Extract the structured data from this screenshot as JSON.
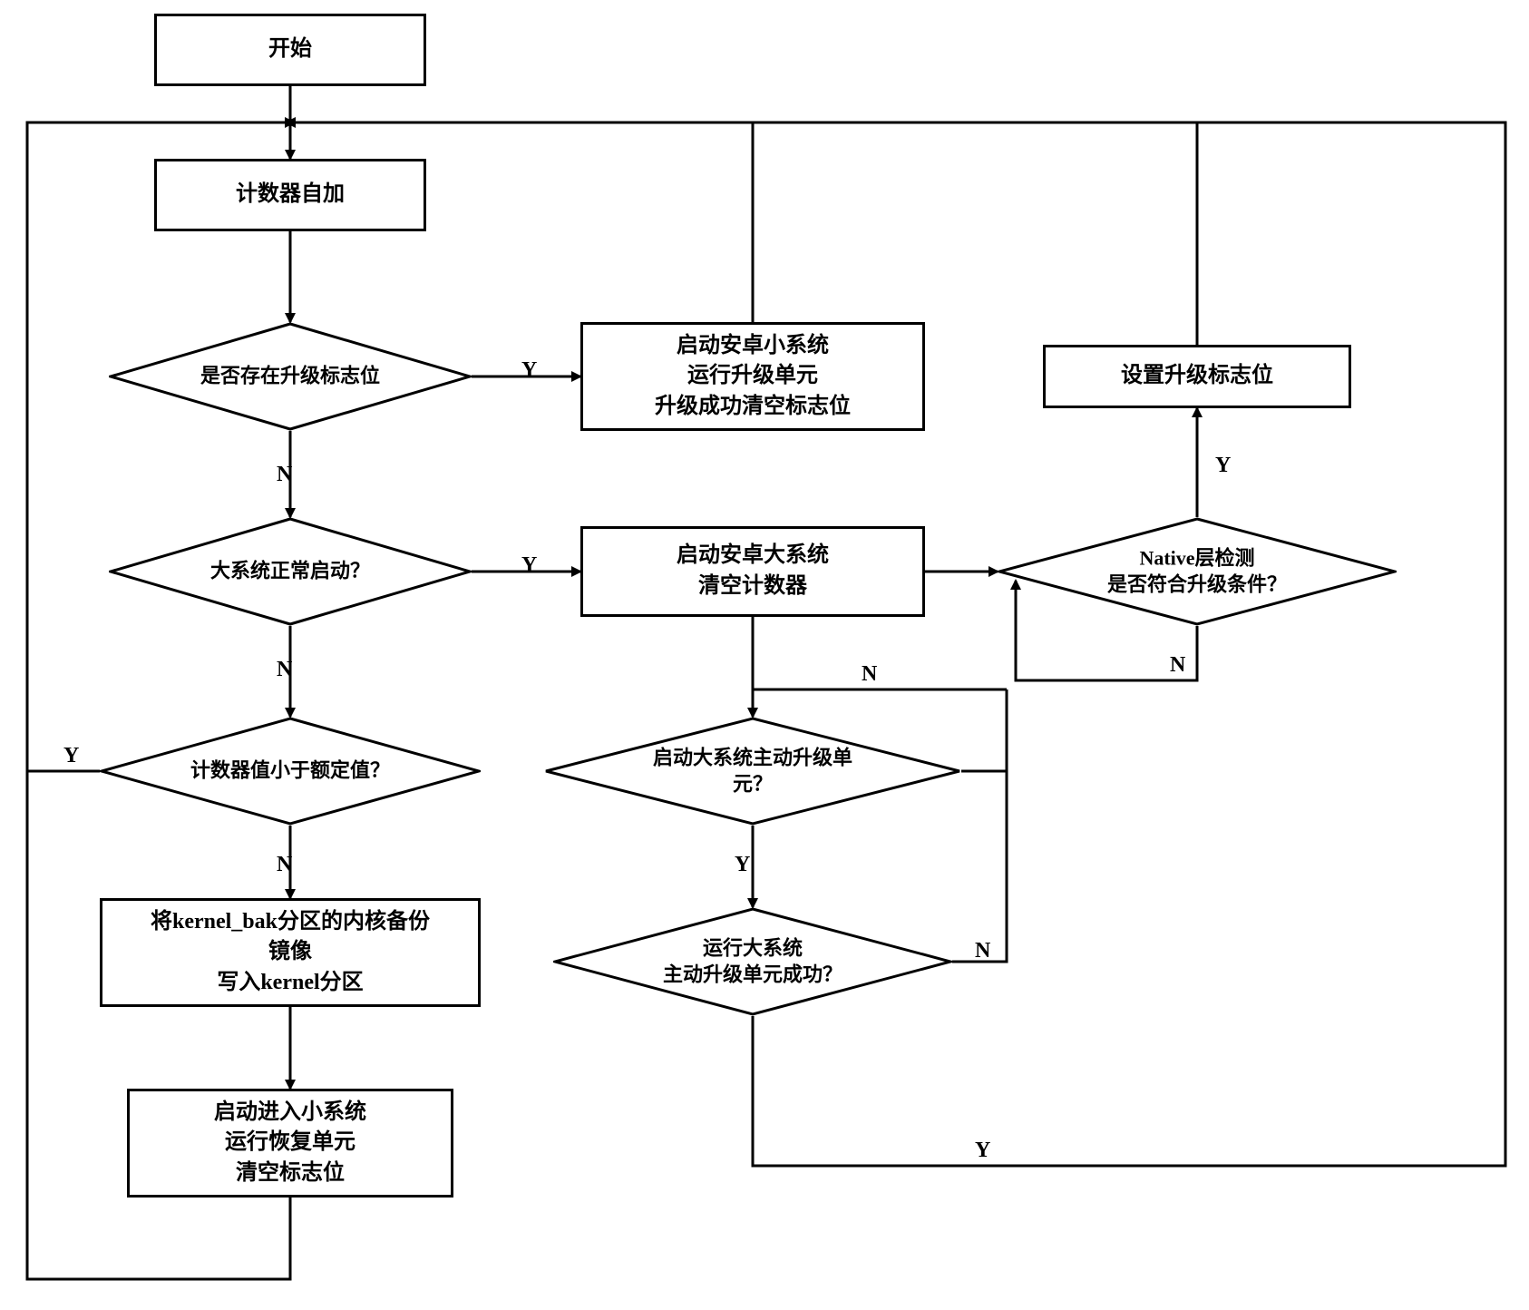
{
  "nodes": {
    "start": "开始",
    "counter_inc": "计数器自加",
    "upgrade_flag_q": "是否存在升级标志位",
    "boot_small": "启动安卓小系统\n运行升级单元\n升级成功清空标志位",
    "big_boot_q": "大系统正常启动？",
    "boot_big": "启动安卓大系统\n清空计数器",
    "counter_lt_q": "计数器值小于额定值？",
    "write_kernel": "将kernel_bak分区的内核备份\n镜像\n写入kernel分区",
    "enter_small": "启动进入小系统\n运行恢复单元\n清空标志位",
    "start_active_q": "启动大系统主动升级单\n元？",
    "run_active_q": "运行大系统\n主动升级单元成功？",
    "native_q": "Native层检测\n是否符合升级条件？",
    "set_flag": "设置升级标志位"
  },
  "labels": {
    "Y": "Y",
    "N": "N"
  },
  "chart_data": {
    "type": "flowchart",
    "nodes": [
      {
        "id": "start",
        "type": "terminal",
        "text": "开始"
      },
      {
        "id": "counter_inc",
        "type": "process",
        "text": "计数器自加"
      },
      {
        "id": "upgrade_flag_q",
        "type": "decision",
        "text": "是否存在升级标志位"
      },
      {
        "id": "boot_small",
        "type": "process",
        "text": "启动安卓小系统 运行升级单元 升级成功清空标志位"
      },
      {
        "id": "big_boot_q",
        "type": "decision",
        "text": "大系统正常启动？"
      },
      {
        "id": "boot_big",
        "type": "process",
        "text": "启动安卓大系统 清空计数器"
      },
      {
        "id": "counter_lt_q",
        "type": "decision",
        "text": "计数器值小于额定值？"
      },
      {
        "id": "write_kernel",
        "type": "process",
        "text": "将kernel_bak分区的内核备份镜像 写入kernel分区"
      },
      {
        "id": "enter_small",
        "type": "process",
        "text": "启动进入小系统 运行恢复单元 清空标志位"
      },
      {
        "id": "start_active_q",
        "type": "decision",
        "text": "启动大系统主动升级单元？"
      },
      {
        "id": "run_active_q",
        "type": "decision",
        "text": "运行大系统 主动升级单元成功？"
      },
      {
        "id": "native_q",
        "type": "decision",
        "text": "Native层检测 是否符合升级条件？"
      },
      {
        "id": "set_flag",
        "type": "process",
        "text": "设置升级标志位"
      }
    ],
    "edges": [
      {
        "from": "start",
        "to": "counter_inc"
      },
      {
        "from": "counter_inc",
        "to": "upgrade_flag_q"
      },
      {
        "from": "upgrade_flag_q",
        "to": "boot_small",
        "label": "Y"
      },
      {
        "from": "upgrade_flag_q",
        "to": "big_boot_q",
        "label": "N"
      },
      {
        "from": "boot_small",
        "to": "counter_inc"
      },
      {
        "from": "big_boot_q",
        "to": "boot_big",
        "label": "Y"
      },
      {
        "from": "big_boot_q",
        "to": "counter_lt_q",
        "label": "N"
      },
      {
        "from": "counter_lt_q",
        "to": "counter_inc",
        "label": "Y"
      },
      {
        "from": "counter_lt_q",
        "to": "write_kernel",
        "label": "N"
      },
      {
        "from": "write_kernel",
        "to": "enter_small"
      },
      {
        "from": "enter_small",
        "to": "counter_inc"
      },
      {
        "from": "boot_big",
        "to": "native_q"
      },
      {
        "from": "boot_big",
        "to": "start_active_q"
      },
      {
        "from": "start_active_q",
        "to": "run_active_q",
        "label": "Y"
      },
      {
        "from": "start_active_q",
        "to": "boot_big",
        "label": "N"
      },
      {
        "from": "run_active_q",
        "to": "counter_inc",
        "label": "Y"
      },
      {
        "from": "run_active_q",
        "to": "boot_big",
        "label": "N"
      },
      {
        "from": "native_q",
        "to": "set_flag",
        "label": "Y"
      },
      {
        "from": "native_q",
        "to": "native_q",
        "label": "N"
      },
      {
        "from": "set_flag",
        "to": "counter_inc"
      }
    ]
  }
}
